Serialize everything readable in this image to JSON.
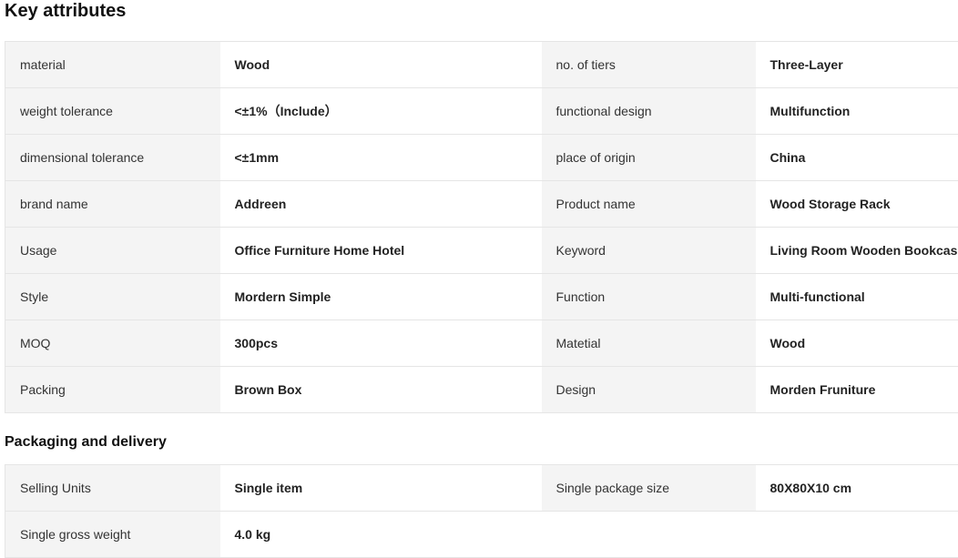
{
  "key_attributes": {
    "title": "Key attributes",
    "rows": [
      {
        "l1": "material",
        "v1": "Wood",
        "l2": "no. of tiers",
        "v2": "Three-Layer"
      },
      {
        "l1": "weight tolerance",
        "v1": "<±1%（Include）",
        "l2": "functional design",
        "v2": "Multifunction"
      },
      {
        "l1": "dimensional tolerance",
        "v1": "<±1mm",
        "l2": "place of origin",
        "v2": "China"
      },
      {
        "l1": "brand name",
        "v1": "Addreen",
        "l2": "Product name",
        "v2": "Wood Storage Rack"
      },
      {
        "l1": "Usage",
        "v1": "Office Furniture Home Hotel",
        "l2": "Keyword",
        "v2": "Living Room Wooden Bookcase"
      },
      {
        "l1": "Style",
        "v1": "Mordern Simple",
        "l2": "Function",
        "v2": "Multi-functional"
      },
      {
        "l1": "MOQ",
        "v1": "300pcs",
        "l2": "Matetial",
        "v2": "Wood"
      },
      {
        "l1": "Packing",
        "v1": "Brown Box",
        "l2": "Design",
        "v2": "Morden Fruniture"
      }
    ]
  },
  "packaging": {
    "title": "Packaging and delivery",
    "rows": [
      {
        "l1": "Selling Units",
        "v1": "Single item",
        "l2": "Single package size",
        "v2": "80X80X10 cm"
      },
      {
        "l1": "Single gross weight",
        "v1": "4.0 kg",
        "l2": "",
        "v2": ""
      }
    ]
  }
}
